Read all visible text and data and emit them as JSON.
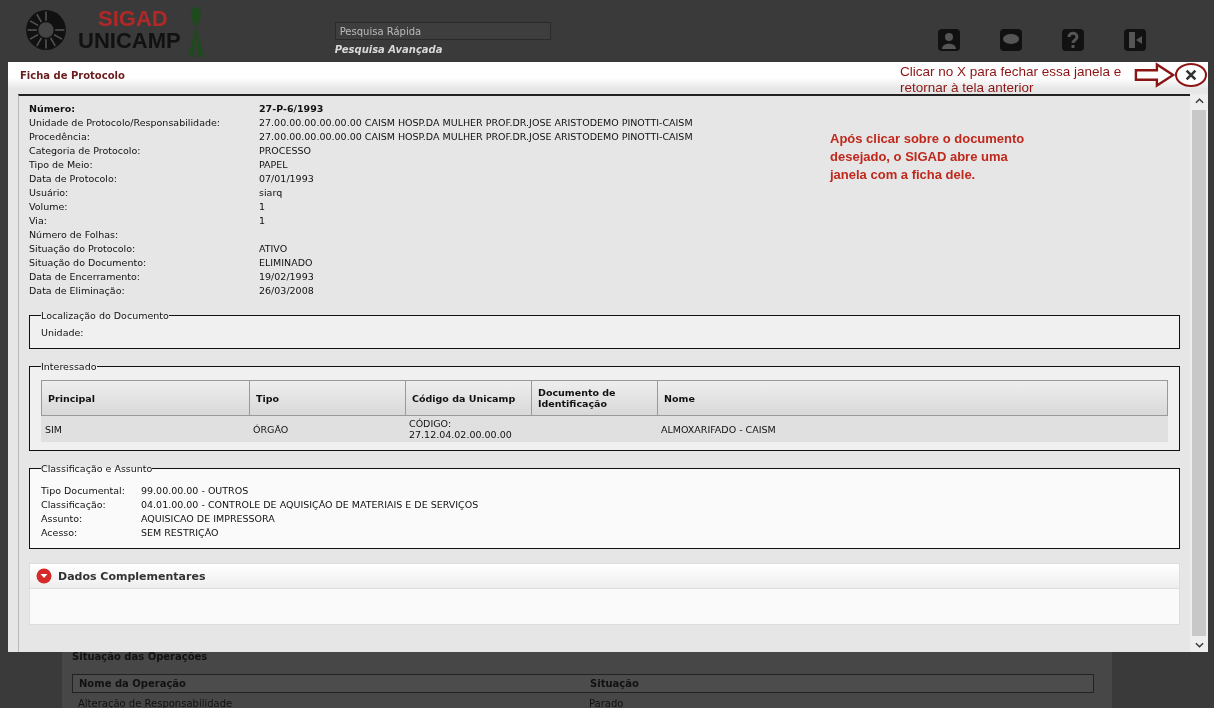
{
  "header": {
    "logo_top": "SIGAD",
    "logo_bottom": "UNICAMP",
    "search": {
      "placeholder": "Pesquisa Rápida"
    },
    "advanced_search": "Pesquisa Avançada"
  },
  "background": {
    "section_title": "Situação das Operações",
    "columns": [
      "Nome da Operação",
      "Situação"
    ],
    "rows": [
      [
        "Alteração de Responsabilidade",
        "Parado"
      ]
    ]
  },
  "modal": {
    "title": "Ficha de Protocolo",
    "fields": [
      {
        "label": "Número:",
        "value": "27-P-6/1993",
        "bold": true
      },
      {
        "label": "Unidade de Protocolo/Responsabilidade:",
        "value": "27.00.00.00.00.00.00 CAISM HOSP.DA MULHER PROF.DR.JOSE ARISTODEMO PINOTTI-CAISM",
        "bold": false
      },
      {
        "label": "Procedência:",
        "value": "27.00.00.00.00.00.00 CAISM HOSP.DA MULHER PROF.DR.JOSE ARISTODEMO PINOTTI-CAISM",
        "bold": false
      },
      {
        "label": "Categoria de Protocolo:",
        "value": "PROCESSO",
        "bold": false
      },
      {
        "label": "Tipo de Meio:",
        "value": "PAPEL",
        "bold": false
      },
      {
        "label": "Data de Protocolo:",
        "value": "07/01/1993",
        "bold": false
      },
      {
        "label": "Usuário:",
        "value": "siarq",
        "bold": false
      },
      {
        "label": "Volume:",
        "value": "1",
        "bold": false
      },
      {
        "label": "Via:",
        "value": "1",
        "bold": false
      },
      {
        "label": "Número de Folhas:",
        "bold": false
      },
      {
        "label": "Situação do Protocolo:",
        "value": "ATIVO",
        "bold": false
      },
      {
        "label": "Situação do Documento:",
        "value": "ELIMINADO",
        "bold": false
      },
      {
        "label": "Data de Encerramento:",
        "value": "19/02/1993",
        "bold": false
      },
      {
        "label": "Data de Eliminação:",
        "value": "26/03/2008",
        "bold": false
      }
    ],
    "location": {
      "legend": "Localização do Documento",
      "fields": [
        {
          "label": "Unidade:"
        }
      ]
    },
    "interested": {
      "legend": "Interessado",
      "columns": [
        "Principal",
        "Tipo",
        "Código da Unicamp",
        "Documento de Identificação",
        "Nome"
      ],
      "rows": [
        [
          "SIM",
          "ÓRGÃO",
          "CÓDIGO: 27.12.04.02.00.00.00",
          "",
          "ALMOXARIFADO - CAISM"
        ]
      ]
    },
    "classification": {
      "legend": "Classificação e Assunto",
      "fields": [
        {
          "label": "Tipo Documental:",
          "value": "99.00.00.00 - OUTROS"
        },
        {
          "label": "Classificação:",
          "value": "04.01.00.00 - CONTROLE DE AQUISIÇÃO DE MATERIAIS E DE SERVIÇOS"
        },
        {
          "label": "Assunto:",
          "value": "AQUISICAO DE IMPRESSORA"
        },
        {
          "label": "Acesso:",
          "value": "SEM RESTRIÇÃO"
        }
      ]
    },
    "complementary": {
      "title": "Dados Complementares",
      "expanded": false
    }
  },
  "annotations": {
    "close_hint": "Clicar no X para fechar essa janela e retornar à tela anterior",
    "note": "Após clicar sobre o documento desejado, o SIGAD abre uma janela com a ficha dele."
  }
}
